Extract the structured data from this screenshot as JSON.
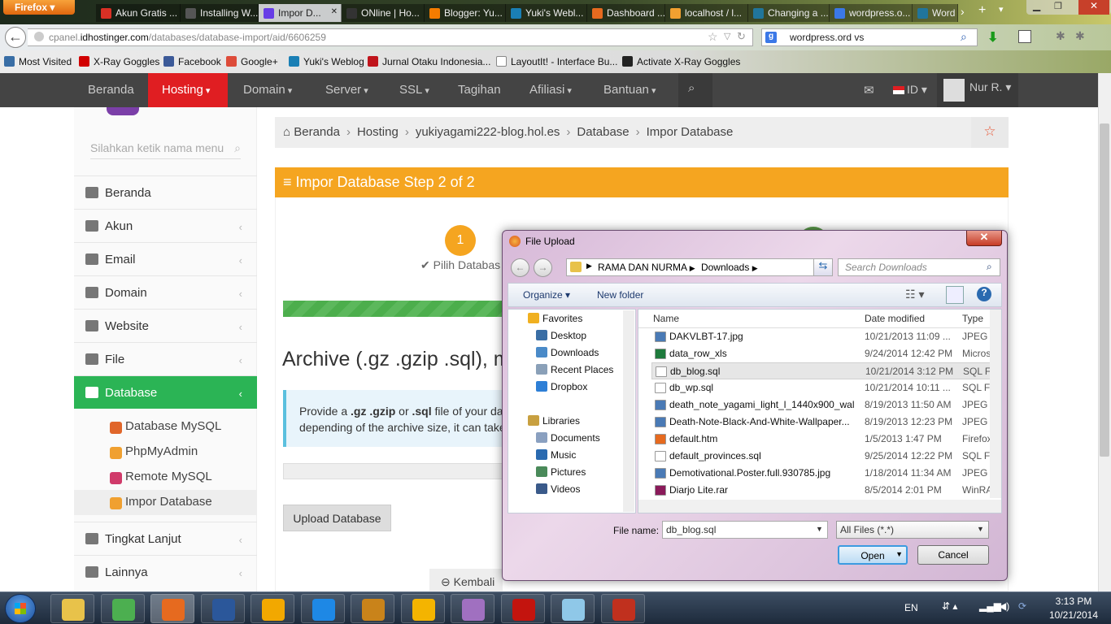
{
  "browser": {
    "firefox_label": "Firefox",
    "tabs": [
      {
        "label": "Akun Gratis ...",
        "icon": "gmail-icon",
        "color": "#d93025",
        "active": false
      },
      {
        "label": "Installing W...",
        "icon": "wordpress-icon",
        "color": "#555",
        "active": false
      },
      {
        "label": "Impor D...",
        "icon": "hostinger-icon",
        "color": "#673de6",
        "active": true
      },
      {
        "label": "ONline | Ho...",
        "icon": "page-icon",
        "color": "#333",
        "active": false
      },
      {
        "label": "Blogger: Yu...",
        "icon": "blogger-icon",
        "color": "#f57c00",
        "active": false
      },
      {
        "label": "Yuki's Webl...",
        "icon": "snowflake-icon",
        "color": "#1a7fb5",
        "active": false
      },
      {
        "label": "Dashboard ...",
        "icon": "dashboard-icon",
        "color": "#e66a1f",
        "active": false
      },
      {
        "label": "localhost / l...",
        "icon": "phpmyadmin-icon",
        "color": "#f2a030",
        "active": false
      },
      {
        "label": "Changing a ...",
        "icon": "wordpress-icon",
        "color": "#21759b",
        "active": false
      },
      {
        "label": "wordpress.o...",
        "icon": "google-icon",
        "color": "#3b78e7",
        "active": false
      },
      {
        "label": "Word",
        "icon": "wordpress-icon",
        "color": "#21759b",
        "active": false
      }
    ],
    "url_prefix": "cpanel.",
    "url_domain": "idhostinger.com",
    "url_path": "/databases/database-import/aid/6606259",
    "search_value": "wordpress.ord vs",
    "bookmarks": [
      {
        "label": "Most Visited",
        "icon": "most-visited-icon",
        "color": "#3a6ea5"
      },
      {
        "label": "X-Ray Goggles",
        "icon": "xray-icon",
        "color": "#d10000"
      },
      {
        "label": "Facebook",
        "icon": "facebook-icon",
        "color": "#3b5998"
      },
      {
        "label": "Google+",
        "icon": "googleplus-icon",
        "color": "#dd4b39"
      },
      {
        "label": "Yuki's Weblog",
        "icon": "snowflake-icon",
        "color": "#1a7fb5"
      },
      {
        "label": "Jurnal Otaku Indonesia...",
        "icon": "otaku-icon",
        "color": "#c0141c"
      },
      {
        "label": "LayoutIt! - Interface Bu...",
        "icon": "layoutit-icon",
        "color": "#fff"
      },
      {
        "label": "Activate X-Ray Goggles",
        "icon": "bookmark-icon",
        "color": "#222"
      }
    ]
  },
  "site": {
    "nav": [
      {
        "label": "Beranda",
        "active": false
      },
      {
        "label": "Hosting",
        "active": true
      },
      {
        "label": "Domain",
        "active": false
      },
      {
        "label": "Server",
        "active": false
      },
      {
        "label": "SSL",
        "active": false
      },
      {
        "label": "Tagihan",
        "active": false
      },
      {
        "label": "Afiliasi",
        "active": false
      },
      {
        "label": "Bantuan",
        "active": false
      }
    ],
    "lang": "ID",
    "user": "Nur R.",
    "menu_search_placeholder": "Silahkan ketik nama menu",
    "sidebar": [
      {
        "label": "Beranda",
        "icon": "dashboard-icon"
      },
      {
        "label": "Akun",
        "icon": "info-icon"
      },
      {
        "label": "Email",
        "icon": "envelope-icon"
      },
      {
        "label": "Domain",
        "icon": "globe-icon"
      },
      {
        "label": "Website",
        "icon": "monitor-icon"
      },
      {
        "label": "File",
        "icon": "folder-icon"
      },
      {
        "label": "Database",
        "icon": "database-icon",
        "active": true
      }
    ],
    "submenu": [
      {
        "label": "Database MySQL",
        "color": "#e0662a"
      },
      {
        "label": "PhpMyAdmin",
        "color": "#f0a030"
      },
      {
        "label": "Remote MySQL",
        "color": "#d03a6a"
      },
      {
        "label": "Impor Database",
        "color": "#f0a030",
        "active": true
      }
    ],
    "sidebar_bottom": [
      {
        "label": "Tingkat Lanjut",
        "icon": "gears-icon"
      },
      {
        "label": "Lainnya",
        "icon": "cog-icon"
      }
    ],
    "breadcrumb": [
      "Beranda",
      "Hosting",
      "yukiyagami222-blog.hol.es",
      "Database",
      "Impor Database"
    ],
    "panel_title": "Impor Database Step 2 of 2",
    "step_number": "1",
    "step_label": "Pilih Databas",
    "archive_title": "Archive (.gz .gzip .sql), ma",
    "info_line1_a": "Provide a ",
    "info_line1_b": ".gz .gzip",
    "info_line1_c": " or ",
    ".info_sql": "",
    "info_line1_d": ".sql",
    "info_line1_e": " file of your data",
    "info_line2": "depending of the archive size, it can take",
    "upload_button": "Upload Database",
    "back_link": "Kembali"
  },
  "dialog": {
    "title": "File Upload",
    "path": [
      "RAMA DAN NURMA",
      "Downloads"
    ],
    "search_placeholder": "Search Downloads",
    "organize": "Organize",
    "new_folder": "New folder",
    "nav": {
      "favorites": "Favorites",
      "fav_items": [
        "Desktop",
        "Downloads",
        "Recent Places",
        "Dropbox"
      ],
      "libraries": "Libraries",
      "lib_items": [
        "Documents",
        "Music",
        "Pictures",
        "Videos"
      ]
    },
    "columns": [
      "Name",
      "Date modified",
      "Type"
    ],
    "files": [
      {
        "name": "DAKVLBT-17.jpg",
        "date": "10/21/2013 11:09 ...",
        "type": "JPEG in",
        "color": "#4a7ab5"
      },
      {
        "name": "data_row_xls",
        "date": "9/24/2014 12:42 PM",
        "type": "Micros",
        "color": "#1e7a3c"
      },
      {
        "name": "db_blog.sql",
        "date": "10/21/2014 3:12 PM",
        "type": "SQL Fi",
        "color": "#fff",
        "selected": true
      },
      {
        "name": "db_wp.sql",
        "date": "10/21/2014 10:11 ...",
        "type": "SQL Fi",
        "color": "#fff"
      },
      {
        "name": "death_note_yagami_light_l_1440x900_wal...",
        "date": "8/19/2013 11:50 AM",
        "type": "JPEG in",
        "color": "#4a7ab5"
      },
      {
        "name": "Death-Note-Black-And-White-Wallpaper...",
        "date": "8/19/2013 12:23 PM",
        "type": "JPEG in",
        "color": "#4a7ab5"
      },
      {
        "name": "default.htm",
        "date": "1/5/2013 1:47 PM",
        "type": "Firefox",
        "color": "#e66a1f"
      },
      {
        "name": "default_provinces.sql",
        "date": "9/25/2014 12:22 PM",
        "type": "SQL Fi",
        "color": "#fff"
      },
      {
        "name": "Demotivational.Poster.full.930785.jpg",
        "date": "1/18/2014 11:34 AM",
        "type": "JPEG in",
        "color": "#4a7ab5"
      },
      {
        "name": "Diarjo Lite.rar",
        "date": "8/5/2014 2:01 PM",
        "type": "WinRA",
        "color": "#8a1a5a"
      }
    ],
    "file_name_label": "File name:",
    "file_name_value": "db_blog.sql",
    "file_type": "All Files (*.*)",
    "open": "Open",
    "cancel": "Cancel"
  },
  "taskbar": {
    "apps": [
      {
        "icon": "explorer-icon",
        "color": "#e8c24a"
      },
      {
        "icon": "chrome-icon",
        "color": "#4caf50"
      },
      {
        "icon": "firefox-icon",
        "color": "#e66a1f",
        "active": true
      },
      {
        "icon": "word-icon",
        "color": "#2b579a"
      },
      {
        "icon": "outlook-icon",
        "color": "#f2a800"
      },
      {
        "icon": "lync-icon",
        "color": "#1e88e5"
      },
      {
        "icon": "sublime-icon",
        "color": "#c9831a"
      },
      {
        "icon": "winamp-icon",
        "color": "#f4b400"
      },
      {
        "icon": "app-icon",
        "color": "#a070c0"
      },
      {
        "icon": "filezilla-icon",
        "color": "#c3140e"
      },
      {
        "icon": "notepad-icon",
        "color": "#8fc8e8"
      },
      {
        "icon": "book-icon",
        "color": "#c0301e"
      }
    ],
    "lang": "EN",
    "time": "3:13 PM",
    "date": "10/21/2014"
  }
}
